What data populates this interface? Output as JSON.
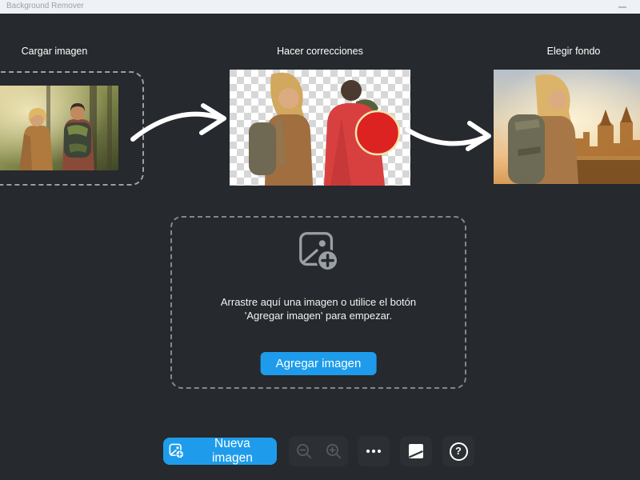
{
  "window": {
    "title": "Background Remover"
  },
  "steps": [
    {
      "label": "Cargar imagen"
    },
    {
      "label": "Hacer correcciones"
    },
    {
      "label": "Elegir fondo"
    }
  ],
  "workflow_images": [
    {
      "name": "original-photo",
      "description": "couple with backpacks in forest"
    },
    {
      "name": "corrections-photo",
      "description": "cutout on transparency checkerboard, subject marked with red brush and red brush cursor circle"
    },
    {
      "name": "new-background-photo",
      "description": "woman with backpack over sunset city background"
    }
  ],
  "dropzone": {
    "icon": "image-add-icon",
    "line1": "Arrastre aquí una imagen o utilice el botón",
    "line2": "'Agregar imagen' para empezar.",
    "button_label": "Agregar imagen"
  },
  "toolbar": {
    "new_image_label": "Nueva imagen",
    "zoom_out_icon": "magnifier-minus-icon",
    "zoom_in_icon": "magnifier-plus-icon",
    "more_icon": "ellipsis-icon",
    "background_icon": "background-swatch-icon",
    "help_glyph": "?"
  },
  "colors": {
    "accent_blue": "#1e9ceb",
    "background": "#26292d",
    "titlebar": "#eef1f6",
    "marker_red": "#dd2222",
    "toolbar_button": "#2c3035"
  }
}
